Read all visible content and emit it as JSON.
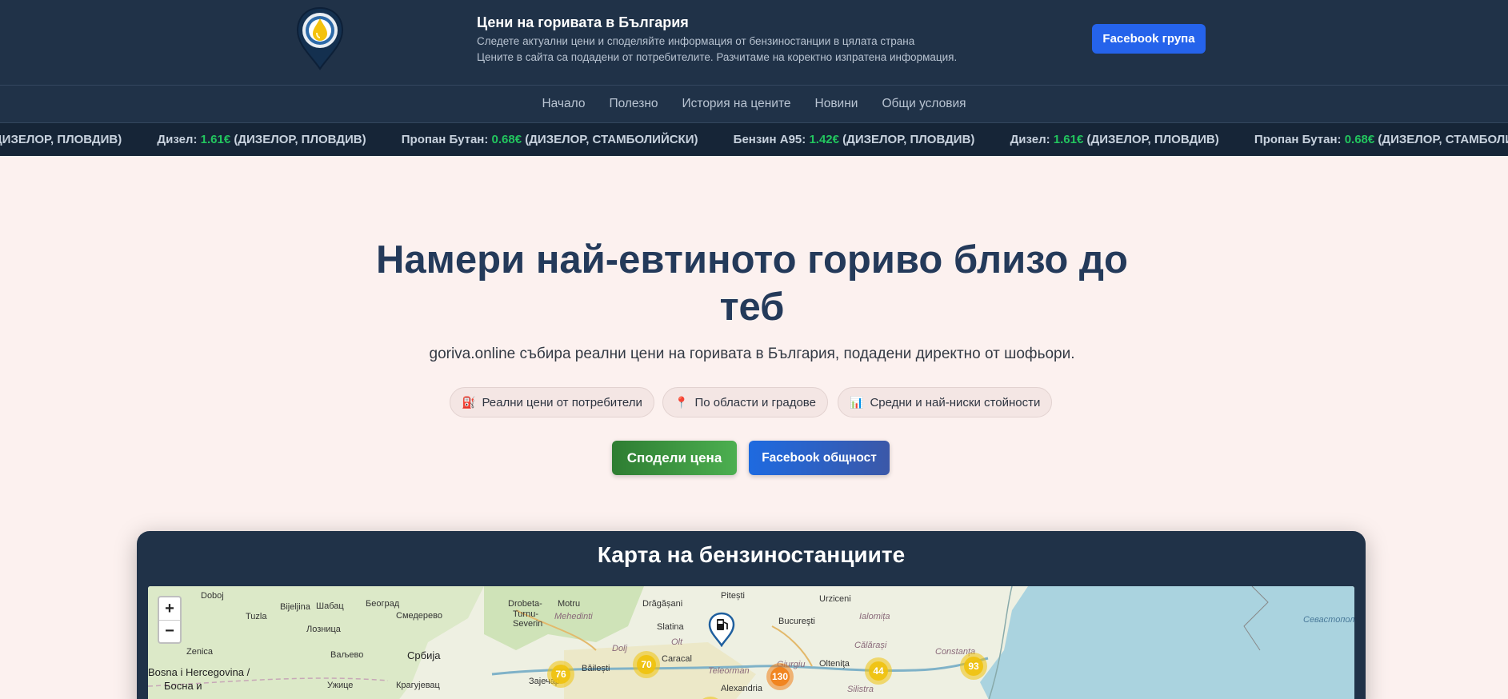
{
  "header": {
    "title": "Цени на горивата в България",
    "subtitle_1": "Следете актуални цени и споделяйте информация от бензиностанции в цялата страна",
    "subtitle_2": "Цените в сайта са подадени от потребителите. Разчитаме на коректно изпратена информация.",
    "facebook_group_label": "Facebook група",
    "logo_icon": "fuel-drop-pin-icon"
  },
  "nav": {
    "items": [
      "Начало",
      "Полезно",
      "История на цените",
      "Новини",
      "Общи условия"
    ]
  },
  "ticker": {
    "leading": "ДИЗЕЛОР, ПЛОВДИВ)",
    "items": [
      {
        "fuel": "Дизел:",
        "price": "1.61€",
        "place": "(ДИЗЕЛОР, ПЛОВДИВ)"
      },
      {
        "fuel": "Пропан Бутан:",
        "price": "0.68€",
        "place": "(ДИЗЕЛОР, СТАМБОЛИЙСКИ)"
      },
      {
        "fuel": "Бензин А95:",
        "price": "1.42€",
        "place": "(ДИЗЕЛОР, ПЛОВДИВ)"
      },
      {
        "fuel": "Дизел:",
        "price": "1.61€",
        "place": "(ДИЗЕЛОР, ПЛОВДИВ)"
      },
      {
        "fuel": "Пропан Бутан:",
        "price": "0.68€",
        "place": "(ДИЗЕЛОР, СТАМБОЛИЙСКИ)"
      }
    ],
    "trailing": "Б"
  },
  "hero": {
    "title": "Намери най-евтиното гориво близо до теб",
    "subtitle": "goriva.online събира реални цени на горивата в България, подадени директно от шофьори.",
    "features": [
      {
        "icon": "fuel-pump-icon",
        "glyph": "⛽",
        "label": "Реални цени от потребители"
      },
      {
        "icon": "location-pin-icon",
        "glyph": "📍",
        "label": "По области и градове"
      },
      {
        "icon": "bar-chart-icon",
        "glyph": "📊",
        "label": "Средни и най-ниски стойности"
      }
    ],
    "share_label": "Сподели цена",
    "facebook_community_label": "Facebook общност"
  },
  "map": {
    "title": "Карта на бензиностанциите",
    "zoom_in": "+",
    "zoom_out": "−",
    "labels": [
      "Doboj",
      "Tuzla",
      "Bijeljina",
      "Шабац",
      "Београд",
      "Смедерево",
      "Лозница",
      "Ваљево",
      "Србија",
      "Zenica",
      "Bosna i Hercegovina /",
      "Босна и",
      "Ужице",
      "Крагујевац",
      "Drobeta-",
      "Turnu-",
      "Severin",
      "Motru",
      "Mehedinti",
      "Drăgășani",
      "Pitești",
      "Slatina",
      "Dolj",
      "Olt",
      "Caracal",
      "Băilești",
      "Зајечар",
      "Bucureşti",
      "Urziceni",
      "Ialomița",
      "Călărași",
      "Olteniţa",
      "Constanța",
      "Teleorman",
      "Alexandria",
      "Giurgiu",
      "Silistra",
      "Севастопол"
    ],
    "clusters": [
      {
        "count": "76",
        "color": "y"
      },
      {
        "count": "70",
        "color": "y"
      },
      {
        "count": "130",
        "color": "o"
      },
      {
        "count": "44",
        "color": "y"
      },
      {
        "count": "93",
        "color": "y"
      }
    ]
  }
}
